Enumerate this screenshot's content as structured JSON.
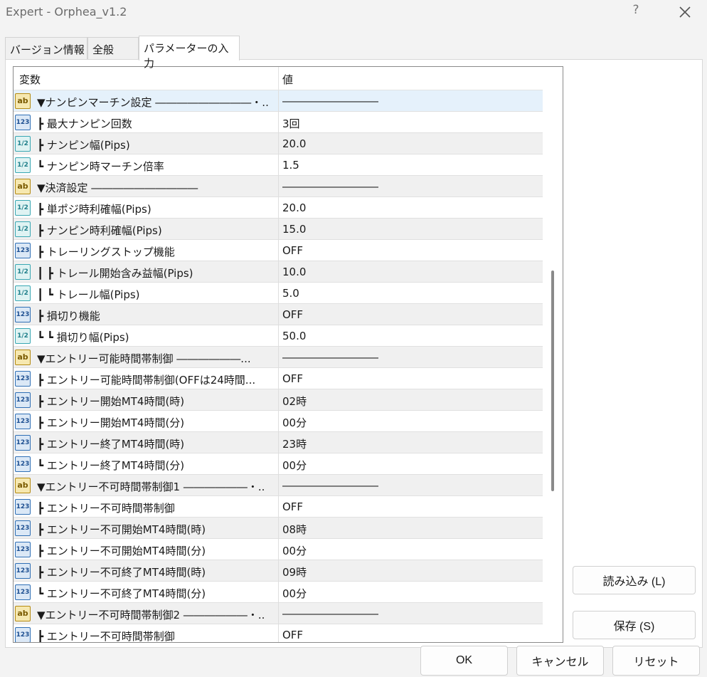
{
  "window": {
    "title": "Expert - Orphea_v1.2",
    "help_label": "?"
  },
  "tabs": [
    {
      "label": "バージョン情報"
    },
    {
      "label": "全般"
    },
    {
      "label": "パラメーターの入力"
    }
  ],
  "grid": {
    "columns": {
      "variable": "変数",
      "value": "値"
    },
    "rows": [
      {
        "icon": "string-icon",
        "name": "▼ナンピンマーチン設定 ―――――――――・..",
        "value": "―――――――――"
      },
      {
        "icon": "integer-icon",
        "name": "┣ 最大ナンピン回数",
        "value": "3回"
      },
      {
        "icon": "double-icon",
        "name": "┣ ナンピン幅(Pips)",
        "value": "20.0"
      },
      {
        "icon": "double-icon",
        "name": "┗ ナンピン時マーチン倍率",
        "value": "1.5"
      },
      {
        "icon": "string-icon",
        "name": "▼決済設定 ――――――――――",
        "value": "―――――――――"
      },
      {
        "icon": "double-icon",
        "name": "┣ 単ポジ時利確幅(Pips)",
        "value": "20.0"
      },
      {
        "icon": "double-icon",
        "name": "┣ ナンピン時利確幅(Pips)",
        "value": "15.0"
      },
      {
        "icon": "integer-icon",
        "name": "┣ トレーリングストップ機能",
        "value": "OFF"
      },
      {
        "icon": "double-icon",
        "name": "┃ ┣ トレール開始含み益幅(Pips)",
        "value": "10.0"
      },
      {
        "icon": "double-icon",
        "name": "┃ ┗ トレール幅(Pips)",
        "value": "5.0"
      },
      {
        "icon": "integer-icon",
        "name": "┣ 損切り機能",
        "value": "OFF"
      },
      {
        "icon": "double-icon",
        "name": "┗ ┗ 損切り幅(Pips)",
        "value": "50.0"
      },
      {
        "icon": "string-icon",
        "name": "▼エントリー可能時間帯制御 ――――――...",
        "value": "―――――――――"
      },
      {
        "icon": "integer-icon",
        "name": "┣ エントリー可能時間帯制御(OFFは24時間...",
        "value": "OFF"
      },
      {
        "icon": "integer-icon",
        "name": "┣ エントリー開始MT4時間(時)",
        "value": "02時"
      },
      {
        "icon": "integer-icon",
        "name": "┣ エントリー開始MT4時間(分)",
        "value": "00分"
      },
      {
        "icon": "integer-icon",
        "name": "┣ エントリー終了MT4時間(時)",
        "value": "23時"
      },
      {
        "icon": "integer-icon",
        "name": "┗ エントリー終了MT4時間(分)",
        "value": "00分"
      },
      {
        "icon": "string-icon",
        "name": "▼エントリー不可時間帯制御1 ――――――・..",
        "value": "―――――――――"
      },
      {
        "icon": "integer-icon",
        "name": "┣ エントリー不可時間帯制御",
        "value": "OFF"
      },
      {
        "icon": "integer-icon",
        "name": "┣ エントリー不可開始MT4時間(時)",
        "value": "08時"
      },
      {
        "icon": "integer-icon",
        "name": "┣ エントリー不可開始MT4時間(分)",
        "value": "00分"
      },
      {
        "icon": "integer-icon",
        "name": "┣ エントリー不可終了MT4時間(時)",
        "value": "09時"
      },
      {
        "icon": "integer-icon",
        "name": "┗ エントリー不可終了MT4時間(分)",
        "value": "00分"
      },
      {
        "icon": "string-icon",
        "name": "▼エントリー不可時間帯制御2 ――――――・..",
        "value": "―――――――――"
      },
      {
        "icon": "integer-icon",
        "name": "┣ エントリー不可時間帯制御",
        "value": "OFF"
      }
    ]
  },
  "icons": {
    "string": "ab",
    "integer": "123",
    "double": "1/2"
  },
  "buttons": {
    "load": "読み込み (L)",
    "save": "保存 (S)",
    "ok": "OK",
    "cancel": "キャンセル",
    "reset": "リセット"
  },
  "colors": {
    "selected_row": "#e5f1fb",
    "alt_row": "#f0f0f0"
  }
}
